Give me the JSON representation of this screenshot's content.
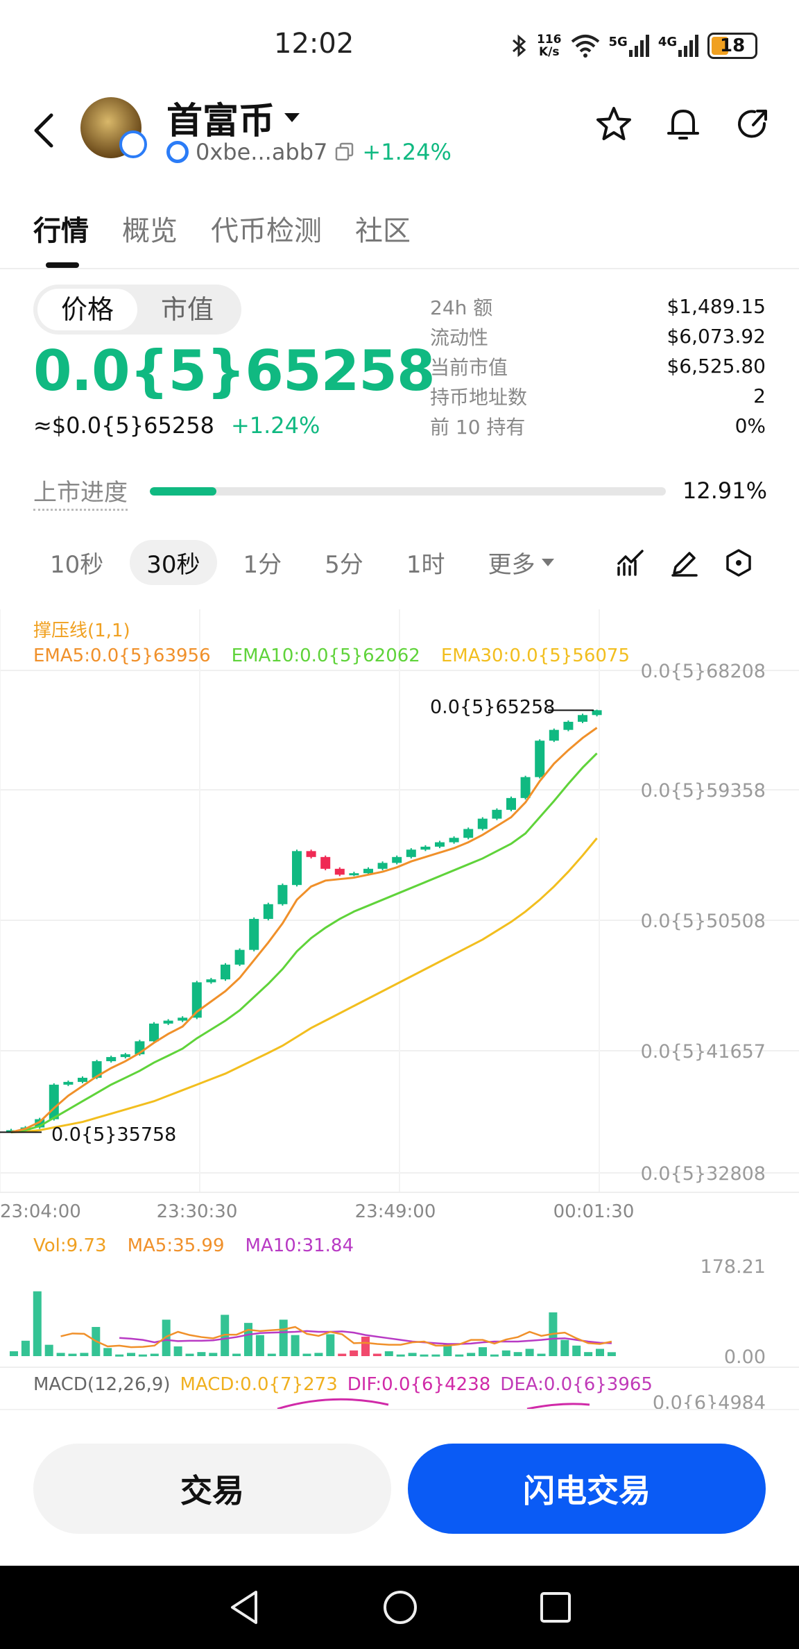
{
  "status_bar": {
    "time": "12:02",
    "net_speed_value": "116",
    "net_speed_unit": "K/s",
    "signal1_label": "5G",
    "signal2_label": "4G",
    "battery": "18"
  },
  "header": {
    "coin_name": "首富币",
    "address": "0xbe...abb7",
    "change": "+1.24%"
  },
  "tabs": [
    {
      "label": "行情",
      "active": true
    },
    {
      "label": "概览",
      "active": false
    },
    {
      "label": "代币检测",
      "active": false
    },
    {
      "label": "社区",
      "active": false
    }
  ],
  "price_toggle": {
    "price": "价格",
    "market_cap": "市值"
  },
  "price": {
    "main": "0.0{5}65258",
    "usd": "≈$0.0{5}65258",
    "change": "+1.24%"
  },
  "stats": [
    {
      "label": "24h  额",
      "value": "$1,489.15"
    },
    {
      "label": "流动性",
      "value": "$6,073.92"
    },
    {
      "label": "当前市值",
      "value": "$6,525.80"
    },
    {
      "label": "持币地址数",
      "value": "2"
    },
    {
      "label": "前 10 持有",
      "value": "0%"
    }
  ],
  "listing": {
    "label": "上市进度",
    "value": "12.91%",
    "fraction": 0.1291
  },
  "intervals": {
    "items": [
      {
        "label": "10秒",
        "active": false
      },
      {
        "label": "30秒",
        "active": true
      },
      {
        "label": "1分",
        "active": false
      },
      {
        "label": "5分",
        "active": false
      },
      {
        "label": "1时",
        "active": false
      }
    ],
    "more": "更多"
  },
  "chart_data": {
    "type": "candlestick",
    "indicator_label": "撑压线(1,1)",
    "ema_labels": {
      "ema5": "EMA5:0.0{5}63956",
      "ema10": "EMA10:0.0{5}62062",
      "ema30": "EMA30:0.0{5}56075"
    },
    "y_ticks": [
      "0.0{5}68208",
      "0.0{5}59358",
      "0.0{5}50508",
      "0.0{5}41657",
      "0.0{5}32808"
    ],
    "y_tick_values": [
      68208,
      59358,
      50508,
      41657,
      32808
    ],
    "x_ticks": [
      "23:04:00",
      "23:30:30",
      "23:49:00",
      "00:01:30"
    ],
    "high_label": "0.0{5}65258",
    "low_label": "0.0{5}35758",
    "candles": [
      [
        35758,
        35900,
        35700,
        36000
      ],
      [
        35900,
        36100,
        35800,
        36200
      ],
      [
        36100,
        36700,
        36000,
        36800
      ],
      [
        36700,
        39200,
        36600,
        39300
      ],
      [
        39200,
        39400,
        39100,
        39500
      ],
      [
        39400,
        39700,
        39300,
        39800
      ],
      [
        39700,
        40900,
        39600,
        41000
      ],
      [
        40900,
        41200,
        40800,
        41300
      ],
      [
        41200,
        41400,
        41100,
        41500
      ],
      [
        41400,
        42300,
        41300,
        42400
      ],
      [
        42300,
        43500,
        42200,
        43600
      ],
      [
        43500,
        43700,
        43400,
        43800
      ],
      [
        43700,
        43900,
        43600,
        44000
      ],
      [
        43900,
        46300,
        43800,
        46400
      ],
      [
        46300,
        46500,
        46200,
        46600
      ],
      [
        46500,
        47500,
        46400,
        47600
      ],
      [
        47500,
        48500,
        47400,
        48600
      ],
      [
        48500,
        50600,
        48400,
        50700
      ],
      [
        50600,
        51600,
        50500,
        51700
      ],
      [
        51600,
        52900,
        51500,
        53000
      ],
      [
        52900,
        55200,
        52800,
        55300
      ],
      [
        55200,
        54800,
        54700,
        55300
      ],
      [
        54800,
        54000,
        53900,
        54900
      ],
      [
        54000,
        53600,
        53500,
        54100
      ],
      [
        53600,
        53700,
        53500,
        53800
      ],
      [
        53700,
        54000,
        53600,
        54100
      ],
      [
        54000,
        54400,
        53900,
        54500
      ],
      [
        54400,
        54800,
        54300,
        54900
      ],
      [
        54800,
        55300,
        54700,
        55400
      ],
      [
        55300,
        55500,
        55200,
        55600
      ],
      [
        55500,
        55800,
        55400,
        55900
      ],
      [
        55800,
        56100,
        55700,
        56200
      ],
      [
        56100,
        56700,
        56000,
        56800
      ],
      [
        56700,
        57400,
        56600,
        57500
      ],
      [
        57400,
        58000,
        57300,
        58100
      ],
      [
        58000,
        58800,
        57900,
        58900
      ],
      [
        58800,
        60300,
        58700,
        60400
      ],
      [
        60300,
        63000,
        60200,
        63100
      ],
      [
        63000,
        63800,
        62900,
        63900
      ],
      [
        63800,
        64400,
        63700,
        64500
      ],
      [
        64400,
        64900,
        64300,
        65000
      ],
      [
        64900,
        65258,
        64800,
        65300
      ]
    ],
    "ema5": [
      35758,
      36000,
      36500,
      37500,
      38400,
      39100,
      39800,
      40400,
      40900,
      41500,
      42200,
      42800,
      43300,
      44300,
      45000,
      45700,
      46600,
      47800,
      49000,
      50300,
      51900,
      52800,
      53200,
      53300,
      53400,
      53600,
      53800,
      54100,
      54500,
      54800,
      55100,
      55400,
      55800,
      56300,
      56900,
      57500,
      58500,
      60000,
      61300,
      62300,
      63200,
      63956
    ],
    "ema10": [
      35758,
      35900,
      36200,
      36800,
      37400,
      38000,
      38600,
      39200,
      39700,
      40200,
      40800,
      41300,
      41800,
      42500,
      43100,
      43700,
      44400,
      45300,
      46200,
      47200,
      48400,
      49300,
      50000,
      50600,
      51100,
      51500,
      51900,
      52300,
      52700,
      53100,
      53500,
      53900,
      54300,
      54700,
      55200,
      55700,
      56400,
      57500,
      58600,
      59800,
      61000,
      62062
    ],
    "ema30": [
      35758,
      35800,
      35900,
      36100,
      36300,
      36500,
      36800,
      37100,
      37400,
      37700,
      38000,
      38400,
      38800,
      39200,
      39600,
      40000,
      40500,
      41000,
      41500,
      42000,
      42600,
      43200,
      43700,
      44200,
      44700,
      45200,
      45700,
      46200,
      46700,
      47200,
      47700,
      48200,
      48700,
      49200,
      49800,
      50400,
      51100,
      51900,
      52800,
      53800,
      54900,
      56075
    ]
  },
  "volume": {
    "labels": {
      "vol": "Vol:9.73",
      "ma5": "MA5:35.99",
      "ma10": "MA10:31.84"
    },
    "max_label": "178.21",
    "min_label": "0.00",
    "max_value": 178.21,
    "bars": [
      12,
      38,
      160,
      28,
      8,
      6,
      8,
      72,
      20,
      4,
      8,
      4,
      6,
      90,
      24,
      6,
      10,
      8,
      102,
      6,
      82,
      52,
      6,
      90,
      52,
      6,
      8,
      54,
      6,
      14,
      48,
      6,
      12,
      4,
      8,
      4,
      4,
      30,
      4,
      8,
      22,
      4,
      14,
      10,
      18,
      6,
      108,
      40,
      26,
      10,
      18,
      9.73
    ],
    "ma5": [
      null,
      null,
      null,
      null,
      49,
      56,
      55,
      37,
      24,
      26,
      22,
      23,
      26,
      48,
      60,
      52,
      47,
      44,
      53,
      53,
      65,
      62,
      64,
      66,
      72,
      55,
      50,
      60,
      54,
      32,
      33,
      30,
      28,
      28,
      34,
      36,
      26,
      26,
      29,
      40,
      40,
      31,
      41,
      47,
      60,
      50,
      55,
      58,
      44,
      32,
      30,
      35.99
    ],
    "ma10": [
      null,
      null,
      null,
      null,
      null,
      null,
      null,
      null,
      null,
      45,
      43,
      40,
      34,
      40,
      37,
      38,
      38,
      39,
      43,
      47,
      53,
      57,
      58,
      59,
      60,
      62,
      60,
      60,
      61,
      58,
      52,
      48,
      44,
      40,
      36,
      34,
      32,
      30,
      30,
      31,
      34,
      36,
      36,
      36,
      38,
      40,
      43,
      44,
      40,
      36,
      33,
      31.84
    ]
  },
  "macd": {
    "label": "MACD(12,26,9)",
    "macd": "MACD:0.0{7}273",
    "dif": "DIF:0.0{6}4238",
    "dea": "DEA:0.0{6}3965",
    "axis_label": "0.0{6}4984"
  },
  "buttons": {
    "trade": "交易",
    "flash_trade": "闪电交易"
  },
  "colors": {
    "up": "#10b981",
    "down": "#ef2a54",
    "ema5": "#f0902a",
    "ema10": "#5fd33a",
    "ema30": "#f2be1e",
    "ma10": "#b83ac4",
    "accent": "#0a5bf5"
  }
}
